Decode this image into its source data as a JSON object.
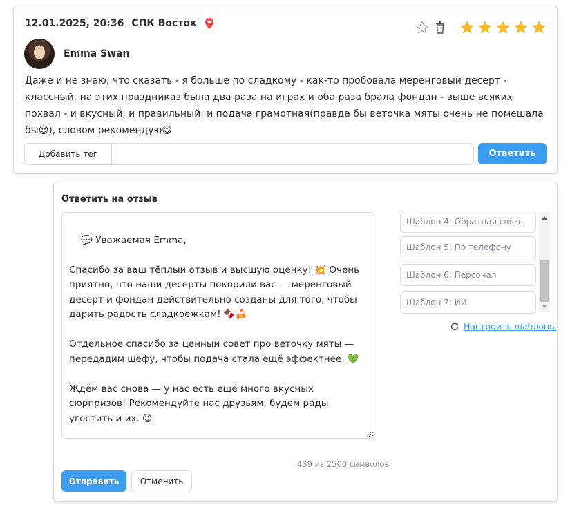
{
  "review": {
    "date": "12.01.2025, 20:36",
    "place": "СПК Восток",
    "author": "Emma Swan",
    "rating": 5,
    "text": "Даже и не знаю, что сказать - я больше по сладкому - как-то пробовала меренговый десерт - классный, на этих праздниказ была два раза на играх и оба раза брала фондан - выше всяких похвал - и вкусный, и правильный, и подача грамотная(правда бы веточка мяты очень не помешала бы😍), словом рекомендую😋",
    "add_tag_label": "Добавить тег",
    "reply_label": "Ответить",
    "icons": [
      "location-pin-icon",
      "star-outline-icon",
      "trash-icon",
      "star-filled-icon"
    ],
    "colors": {
      "accent": "#3b9df0",
      "star": "#f5b82e",
      "pin": "#f0483e"
    }
  },
  "reply": {
    "title": "Ответить на отзыв",
    "text": "💬 Уважаемая Emma,\n\nСпасибо за ваш тёплый отзыв и высшую оценку! 💥 Очень приятно, что наши десерты покорили вас — меренговый десерт и фондан действительно созданы для того, чтобы дарить радость сладкоежкам! 🍫🍰\n\nОтдельное спасибо за ценный совет про веточку мяты — передадим шефу, чтобы подача стала ещё эффектнее. 💚\n\nЖдём вас снова — у нас есть ещё много вкусных сюрпризов! Рекомендуйте нас друзьям, будем рады угостить и их. 😊",
    "char_count": "439 из 2500 символов",
    "send_label": "Отправить",
    "cancel_label": "Отменить",
    "templates": [
      "Шаблон 4: Обратная связь",
      "Шаблон 5: По телефону",
      "Шаблон 6: Персонал",
      "Шаблон 7: ИИ"
    ],
    "configure_label": "Настроить шаблоны"
  }
}
